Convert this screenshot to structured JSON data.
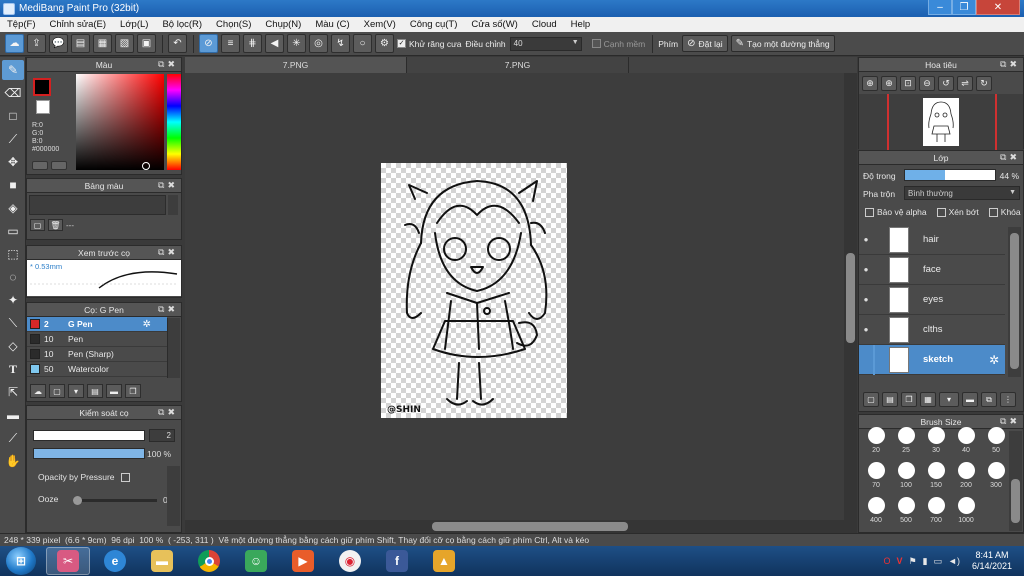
{
  "window": {
    "title": "MediBang Paint Pro (32bit)"
  },
  "menu": [
    "Tệp(F)",
    "Chỉnh sửa(E)",
    "Lớp(L)",
    "Bộ lọc(R)",
    "Chọn(S)",
    "Chụp(N)",
    "Màu (C)",
    "Xem(V)",
    "Công cụ(T)",
    "Cửa số(W)",
    "Cloud",
    "Help"
  ],
  "toolbar": {
    "antialias_label": "Khử răng cưa",
    "adjust_label": "Điều chỉnh",
    "adjust_value": "40",
    "edge_label": "Cạnh mềm",
    "key_label": "Phím",
    "reset_label": "Đặt lại",
    "straight_label": "Tạo một đường thẳng"
  },
  "panels": {
    "color": {
      "title": "Màu",
      "r": "R:0",
      "g": "G:0",
      "b": "B:0",
      "hex": "#000000",
      "fg_color": "#000000",
      "bg_color": "#ffffff"
    },
    "swatches": {
      "title": "Bảng màu",
      "placeholder": "---"
    },
    "brush_preview": {
      "title": "Xem trước cọ",
      "size": "* 0.53mm"
    },
    "brush_list": {
      "title": "Cọ: G Pen",
      "items": [
        {
          "size": "2",
          "name": "G Pen",
          "color": "#d62828",
          "selected": true
        },
        {
          "size": "10",
          "name": "Pen",
          "color": "#2b2b2b",
          "selected": false
        },
        {
          "size": "10",
          "name": "Pen (Sharp)",
          "color": "#2b2b2b",
          "selected": false
        },
        {
          "size": "50",
          "name": "Watercolor",
          "color": "#7fc8ef",
          "selected": false
        }
      ]
    },
    "brush_control": {
      "title": "Kiểm soát cọ",
      "size_value": "2",
      "opacity_value": "100 %",
      "opacity_fraction": 1.0,
      "pressure_label": "Opacity by Pressure",
      "ooze_label": "Ooze",
      "ooze_value": "0"
    }
  },
  "tabs": [
    {
      "label": "7.PNG",
      "active": true
    },
    {
      "label": "7.PNG",
      "active": false
    }
  ],
  "canvas": {
    "signature": "@SHIN"
  },
  "navigator": {
    "title": "Hoa tiêu"
  },
  "layers": {
    "title": "Lớp",
    "opacity_label": "Độ trong",
    "opacity_value": "44 %",
    "opacity_fraction": 0.44,
    "blend_label": "Pha trộn",
    "blend_value": "Bình thường",
    "protect_alpha": "Bảo vệ alpha",
    "clipping": "Xén bớt",
    "lock": "Khóa",
    "items": [
      {
        "name": "hair",
        "selected": false
      },
      {
        "name": "face",
        "selected": false
      },
      {
        "name": "eyes",
        "selected": false
      },
      {
        "name": "clths",
        "selected": false
      },
      {
        "name": "sketch",
        "selected": true
      }
    ]
  },
  "brush_size": {
    "title": "Brush Size",
    "sizes": [
      "20",
      "25",
      "30",
      "40",
      "50",
      "70",
      "100",
      "150",
      "200",
      "300",
      "400",
      "500",
      "700",
      "1000"
    ]
  },
  "status": {
    "dimensions": "248 * 339 pixel",
    "physical": "(6.6 * 9cm)",
    "dpi": "96 dpi",
    "zoom": "100 %",
    "coords": "( -253, 311 )",
    "hint": "Vẽ một đường thẳng bằng cách giữ phím Shift, Thay đổi cỡ cọ bằng cách giữ phím Ctrl, Alt và kéo"
  },
  "taskbar": {
    "time": "8:41 AM",
    "date": "6/14/2021"
  }
}
